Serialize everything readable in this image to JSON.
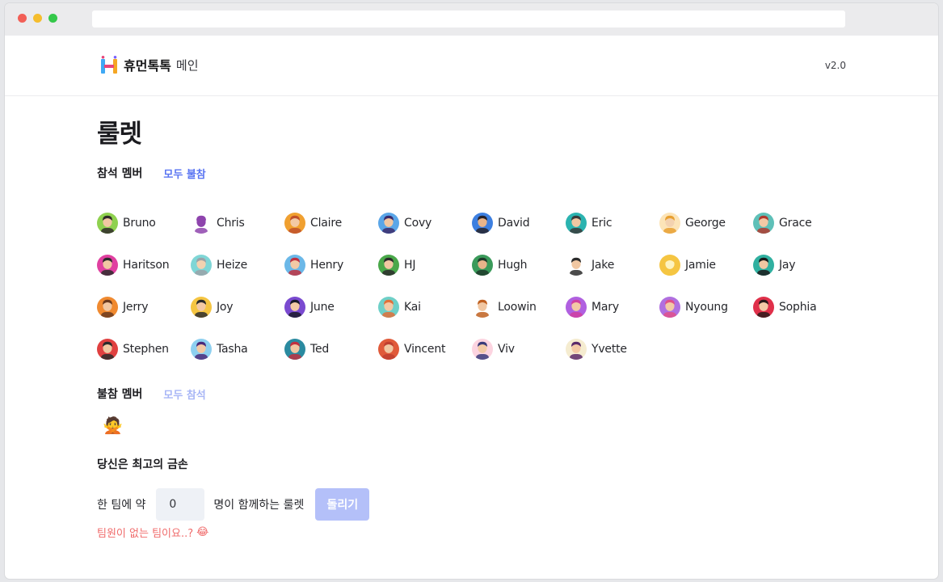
{
  "header": {
    "brand_name": "휴먼톡톡",
    "brand_sub": "메인",
    "version": "v2.0"
  },
  "page": {
    "title": "룰렛"
  },
  "present": {
    "title": "참석 멤버",
    "action": "모두 불참",
    "members": [
      {
        "name": "Bruno",
        "skin": "#f1c7a2",
        "hair": "#2f2a28",
        "bg": "#8fd14f"
      },
      {
        "name": "Chris",
        "skin": "#8e44ad",
        "hair": "#8e44ad",
        "bg": "#ffffff"
      },
      {
        "name": "Claire",
        "skin": "#f3c9a5",
        "hair": "#c0502a",
        "bg": "#f0a030"
      },
      {
        "name": "Covy",
        "skin": "#f1c7a2",
        "hair": "#3b2a6b",
        "bg": "#5aa6e8"
      },
      {
        "name": "David",
        "skin": "#e8b48a",
        "hair": "#25222a",
        "bg": "#3d7fe0"
      },
      {
        "name": "Eric",
        "skin": "#f1c7a2",
        "hair": "#3a3a3a",
        "bg": "#2bb3b0"
      },
      {
        "name": "George",
        "skin": "#f3d2b0",
        "hair": "#e8a030",
        "bg": "#fce4b8"
      },
      {
        "name": "Grace",
        "skin": "#f3c9a5",
        "hair": "#b03a2e",
        "bg": "#5ec0b8"
      },
      {
        "name": "Haritson",
        "skin": "#f1c7a2",
        "hair": "#2b2b2b",
        "bg": "#e040a0"
      },
      {
        "name": "Heize",
        "skin": "#f3d2b0",
        "hair": "#9aa2a8",
        "bg": "#7fd6d6"
      },
      {
        "name": "Henry",
        "skin": "#f3c9a5",
        "hair": "#c03040",
        "bg": "#6bb8e8"
      },
      {
        "name": "HJ",
        "skin": "#f1c7a2",
        "hair": "#2b2b2b",
        "bg": "#4aa84a"
      },
      {
        "name": "Hugh",
        "skin": "#e8b48a",
        "hair": "#1f3a2a",
        "bg": "#3a9a5a"
      },
      {
        "name": "Jake",
        "skin": "#f1c7a2",
        "hair": "#2b2b2b",
        "bg": "#ffffff"
      },
      {
        "name": "Jamie",
        "skin": "#fdf3c0",
        "hair": "#f5c542",
        "bg": "#f5c542"
      },
      {
        "name": "Jay",
        "skin": "#f1c7a2",
        "hair": "#1a1a1a",
        "bg": "#30b0a0"
      },
      {
        "name": "Jerry",
        "skin": "#f1c7a2",
        "hair": "#6b3a1e",
        "bg": "#f08a30"
      },
      {
        "name": "Joy",
        "skin": "#f3c9a5",
        "hair": "#2b2b2b",
        "bg": "#f5c542"
      },
      {
        "name": "June",
        "skin": "#f3c9a5",
        "hair": "#1a1a2a",
        "bg": "#7a4ad0"
      },
      {
        "name": "Kai",
        "skin": "#f3c9a5",
        "hair": "#e0703a",
        "bg": "#6ed0c8"
      },
      {
        "name": "Loowin",
        "skin": "#f1c7a2",
        "hair": "#c06020",
        "bg": "#ffffff"
      },
      {
        "name": "Mary",
        "skin": "#f3c9a5",
        "hair": "#d040a0",
        "bg": "#b060e0"
      },
      {
        "name": "Nyoung",
        "skin": "#f3c9a5",
        "hair": "#e0508a",
        "bg": "#b070e0"
      },
      {
        "name": "Sophia",
        "skin": "#f3c9a5",
        "hair": "#2b1a1a",
        "bg": "#e0304a"
      },
      {
        "name": "Stephen",
        "skin": "#f1c7a2",
        "hair": "#2b2b2b",
        "bg": "#e04040"
      },
      {
        "name": "Tasha",
        "skin": "#f3c9a5",
        "hair": "#4a2a7a",
        "bg": "#8ed0f0"
      },
      {
        "name": "Ted",
        "skin": "#f1c7a2",
        "hair": "#c03040",
        "bg": "#2a8aa0"
      },
      {
        "name": "Vincent",
        "skin": "#f1c7a2",
        "hair": "#c04030",
        "bg": "#e05a3a"
      },
      {
        "name": "Viv",
        "skin": "#f3c9a5",
        "hair": "#3a3a7a",
        "bg": "#fcd4e0"
      },
      {
        "name": "Yvette",
        "skin": "#f3c9a5",
        "hair": "#5a2a6a",
        "bg": "#f5ecd0"
      }
    ]
  },
  "absent": {
    "title": "불참 멤버",
    "action": "모두 참석",
    "members": [
      {
        "icon": "person-gesturing-no-icon",
        "glyph": "🙅"
      }
    ]
  },
  "game": {
    "title": "당신은 최고의 금손",
    "label_prefix": "한 팀에 약",
    "team_size": "0",
    "label_suffix": "명이 함께하는 룰렛",
    "spin_label": "돌리기",
    "warning": "팀원이 없는 팀이요..?",
    "warning_emoji": "😂"
  },
  "colors": {
    "accent": "#5b76f2",
    "accent_light": "#a8b6f6",
    "button_disabled": "#b4c0f9",
    "warning": "#f06b6b"
  }
}
